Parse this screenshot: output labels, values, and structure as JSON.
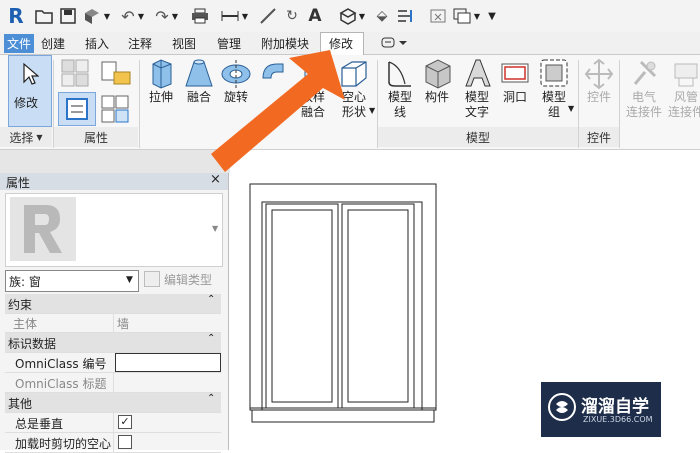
{
  "app_logo": "R",
  "tabs": [
    "文件",
    "创建",
    "插入",
    "注释",
    "视图",
    "管理",
    "附加模块",
    "修改"
  ],
  "ribbon": {
    "modify_label": "修改",
    "select_panel": "选择",
    "properties_panel": "属性",
    "buttons": {
      "extrusion": "拉伸",
      "blend": "融合",
      "revolve": "旋转",
      "sweep_blend_1": "放样",
      "sweep_blend_2": "融合",
      "void_1": "空心",
      "void_2": "形状",
      "model_line_1": "模型",
      "model_line_2": "线",
      "component": "构件",
      "model_text_1": "模型",
      "model_text_2": "文字",
      "opening": "洞口",
      "model_group_1": "模型",
      "model_group_2": "组",
      "control": "控件",
      "elec_conn_1": "电气",
      "elec_conn_2": "连接件",
      "duct_conn_1": "风管",
      "duct_conn_2": "连接件"
    },
    "model_panel": "模型",
    "control_panel": "控件"
  },
  "properties": {
    "title": "属性",
    "type_selector": "族: 窗",
    "edit_type": "编辑类型",
    "rows": [
      {
        "type": "header",
        "label": "约束",
        "value": ""
      },
      {
        "type": "row",
        "label": "主体",
        "value": "墙"
      },
      {
        "type": "header",
        "label": "标识数据",
        "value": ""
      },
      {
        "type": "row",
        "label": "OmniClass 编号",
        "value": ""
      },
      {
        "type": "row",
        "label": "OmniClass 标题",
        "value": ""
      },
      {
        "type": "header",
        "label": "其他",
        "value": ""
      },
      {
        "type": "check",
        "label": "总是垂直",
        "value": "checked"
      },
      {
        "type": "check",
        "label": "加载时剪切的空心",
        "value": "unchecked"
      }
    ]
  },
  "watermark": {
    "title": "溜溜自学",
    "url": "ZIXUE.3D66.COM"
  },
  "colors": {
    "accent_blue": "#2b74c8",
    "arrow_orange": "#f26a22",
    "watermark_bg": "#1e2e4a"
  }
}
